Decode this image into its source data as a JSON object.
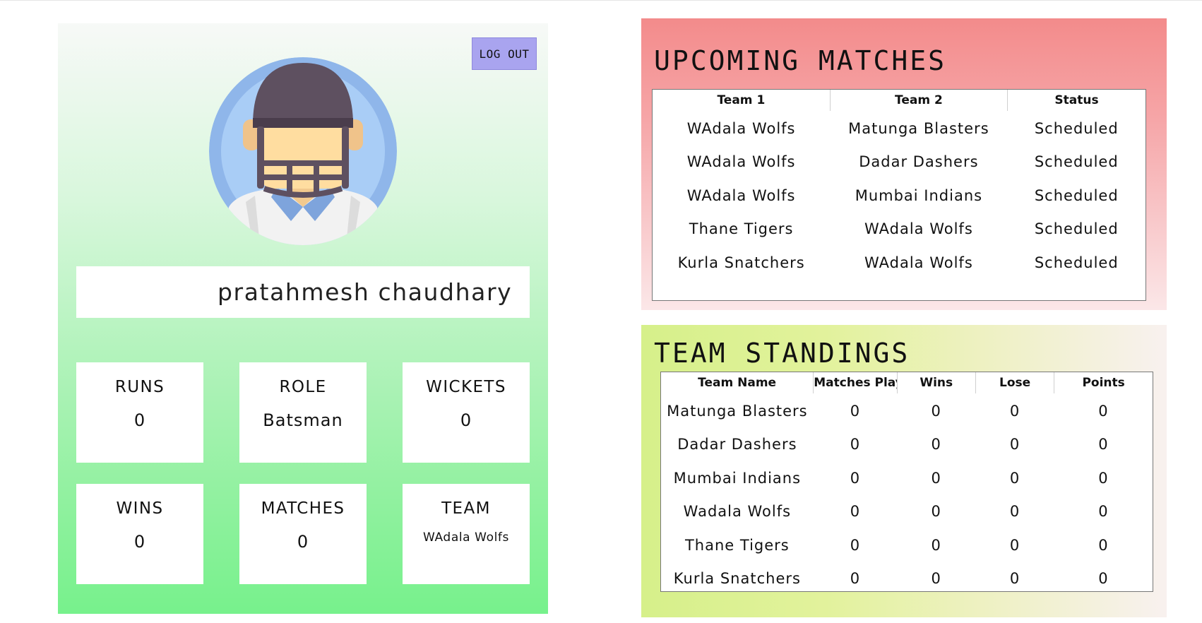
{
  "player": {
    "logout_label": "LOG OUT",
    "name": "pratahmesh chaudhary",
    "avatar_icon": "cricket-player-helmet-icon",
    "stats": {
      "runs": {
        "label": "RUNS",
        "value": "0"
      },
      "role": {
        "label": "ROLE",
        "value": "Batsman"
      },
      "wickets": {
        "label": "WICKETS",
        "value": "0"
      },
      "wins": {
        "label": "WINS",
        "value": "0"
      },
      "matches": {
        "label": "MATCHES",
        "value": "0"
      },
      "team": {
        "label": "TEAM",
        "value": "WAdala Wolfs"
      }
    }
  },
  "upcoming": {
    "title": "UPCOMING MATCHES",
    "columns": [
      "Team 1",
      "Team 2",
      "Status"
    ],
    "rows": [
      [
        "WAdala Wolfs",
        "Matunga Blasters",
        "Scheduled"
      ],
      [
        "WAdala Wolfs",
        "Dadar Dashers",
        "Scheduled"
      ],
      [
        "WAdala Wolfs",
        "Mumbai Indians",
        "Scheduled"
      ],
      [
        "Thane Tigers",
        "WAdala Wolfs",
        "Scheduled"
      ],
      [
        "Kurla Snatchers",
        "WAdala Wolfs",
        "Scheduled"
      ]
    ]
  },
  "standings": {
    "title": "TEAM STANDINGS",
    "columns": [
      "Team Name",
      "Matches Played",
      "Wins",
      "Lose",
      "Points"
    ],
    "rows": [
      [
        "Matunga Blasters",
        "0",
        "0",
        "0",
        "0"
      ],
      [
        "Dadar Dashers",
        "0",
        "0",
        "0",
        "0"
      ],
      [
        "Mumbai Indians",
        "0",
        "0",
        "0",
        "0"
      ],
      [
        "Wadala Wolfs",
        "0",
        "0",
        "0",
        "0"
      ],
      [
        "Thane Tigers",
        "0",
        "0",
        "0",
        "0"
      ],
      [
        "Kurla Snatchers",
        "0",
        "0",
        "0",
        "0"
      ]
    ]
  },
  "colors": {
    "logout_bg": "#a9a4ef",
    "player_gradient_end": "#77f18c",
    "upcoming_gradient_top": "#f38b8b",
    "standings_gradient_left": "#d6f08a"
  }
}
